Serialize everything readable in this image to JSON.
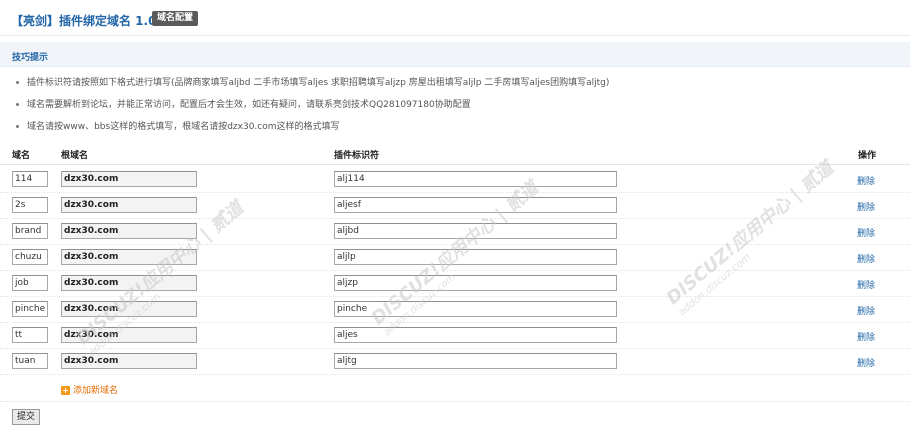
{
  "header": {
    "title": "【亮剑】插件绑定域名 1.0",
    "tag": "域名配置"
  },
  "tips": {
    "title": "技巧提示",
    "items": [
      "插件标识符请按照如下格式进行填写(品牌商家填写aljbd 二手市场填写aljes 求职招聘填写aljzp 房屋出租填写aljlp 二手房填写aljes团购填写aljtg)",
      "域名需要解析到论坛，并能正常访问，配置后才会生效，如还有疑问，请联系亮剑技术QQ281097180协助配置",
      "域名请按www、bbs这样的格式填写，根域名请按dzx30.com这样的格式填写"
    ]
  },
  "table": {
    "headers": {
      "key": "域名",
      "domain": "根域名",
      "plugin": "插件标识符",
      "action": "操作"
    },
    "rows": [
      {
        "key": "114",
        "domain": "dzx30.com",
        "plugin": "alj114",
        "action": "删除"
      },
      {
        "key": "2s",
        "domain": "dzx30.com",
        "plugin": "aljesf",
        "action": "删除"
      },
      {
        "key": "brand",
        "domain": "dzx30.com",
        "plugin": "aljbd",
        "action": "删除"
      },
      {
        "key": "chuzu",
        "domain": "dzx30.com",
        "plugin": "aljlp",
        "action": "删除"
      },
      {
        "key": "job",
        "domain": "dzx30.com",
        "plugin": "aljzp",
        "action": "删除"
      },
      {
        "key": "pinche",
        "domain": "dzx30.com",
        "plugin": "pinche",
        "action": "删除"
      },
      {
        "key": "tt",
        "domain": "dzx30.com",
        "plugin": "aljes",
        "action": "删除"
      },
      {
        "key": "tuan",
        "domain": "dzx30.com",
        "plugin": "aljtg",
        "action": "删除"
      }
    ]
  },
  "add_label": "添加新域名",
  "submit_label": "提交",
  "watermark": {
    "line1": "DISCUZ!应用中心 | 贰道",
    "line2": "addon.discuz.com"
  },
  "colors": {
    "link": "#2366a8",
    "add": "#e36c00",
    "tips_bg": "#f1f5fa"
  }
}
